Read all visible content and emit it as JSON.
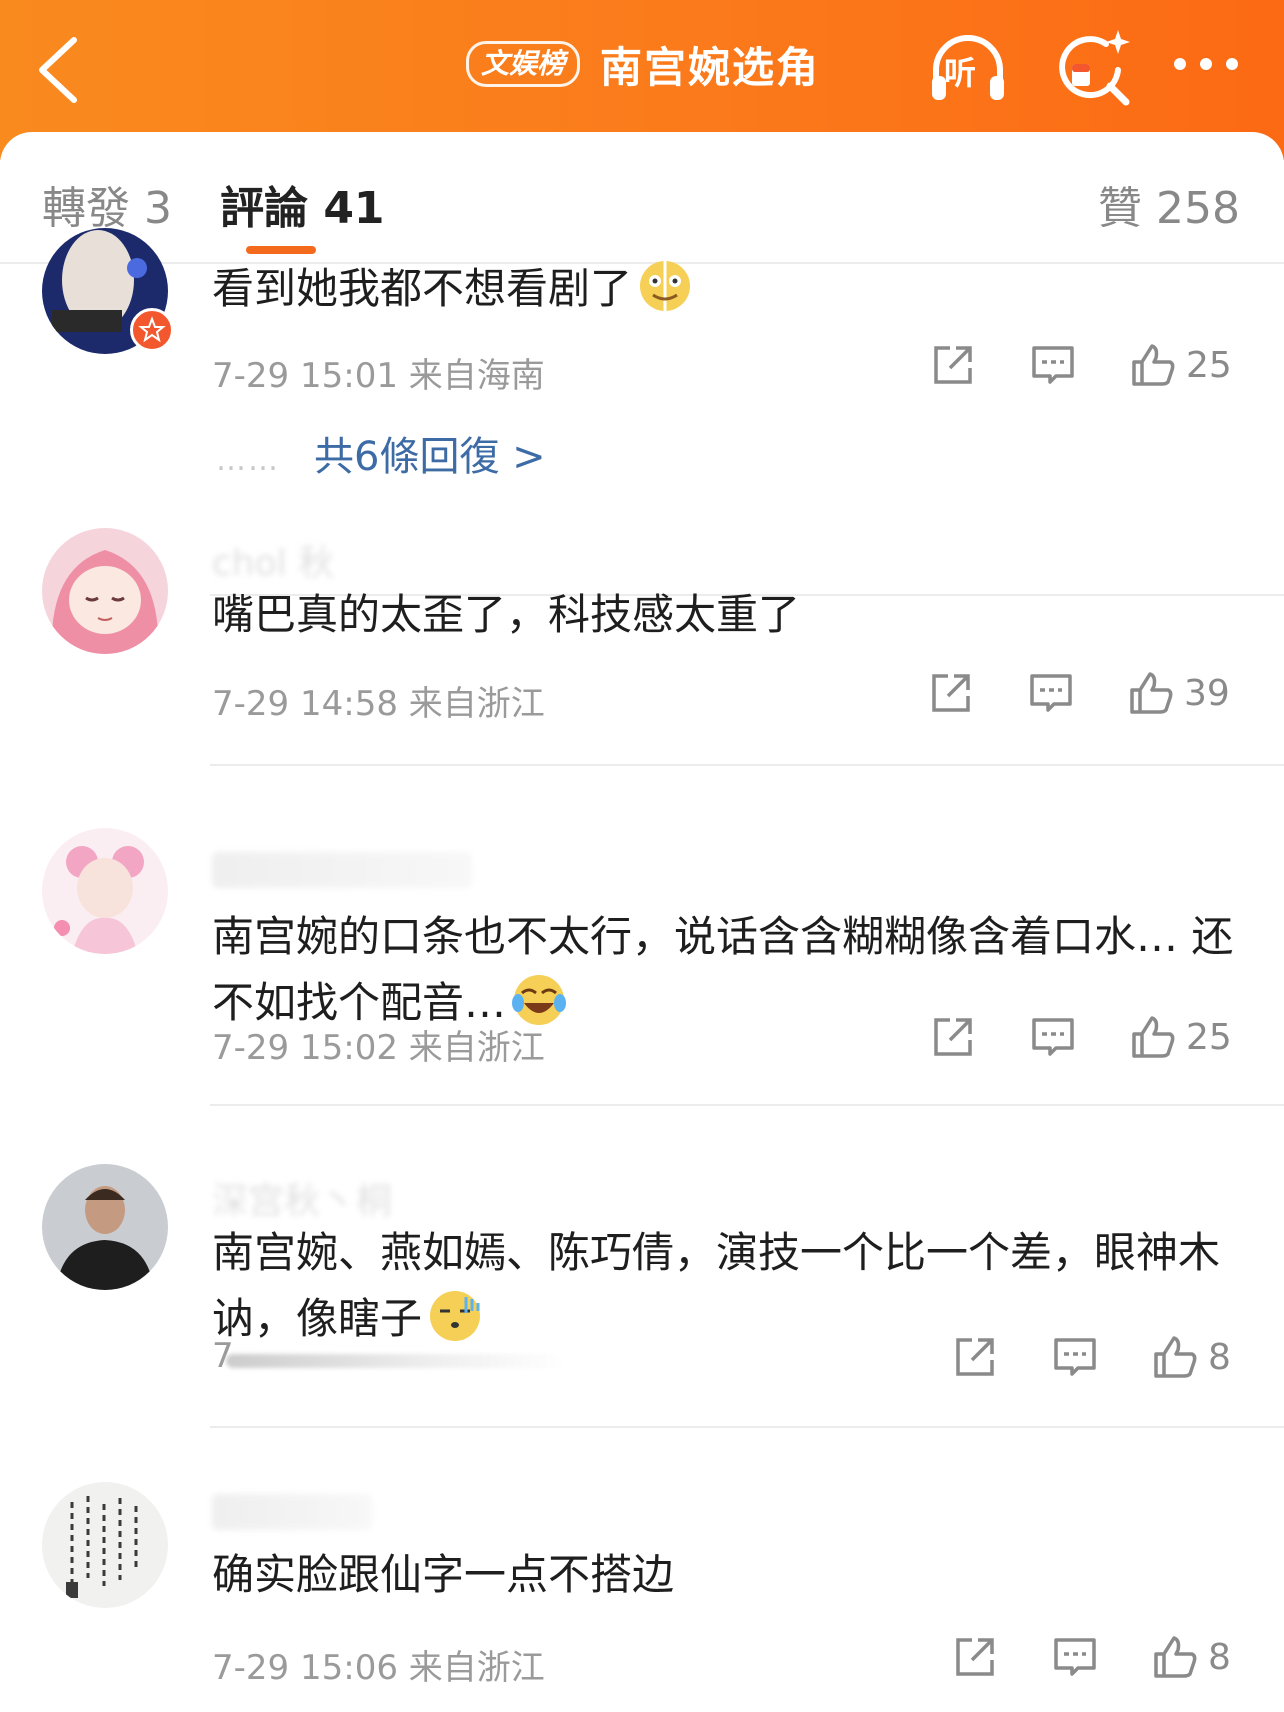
{
  "header": {
    "badge": "文娱榜",
    "title": "南宫婉选角",
    "listen_label": "听",
    "colors": {
      "bg": "#fb7a1b",
      "fg": "#ffffff"
    }
  },
  "tabs": {
    "repost": "轉發 3",
    "comment": "評論 41",
    "like": "贊 258",
    "accent": "#f46a1c"
  },
  "comments": [
    {
      "text": "看到她我都不想看剧了",
      "emoji": "grimace-emoji",
      "time": "7-29 15:01 来自海南",
      "likes": "25",
      "replies": "共6條回復 >",
      "replies_dots": "……"
    },
    {
      "user": "chol 秋",
      "text": "嘴巴真的太歪了，科技感太重了",
      "time": "7-29 14:58 来自浙江",
      "likes": "39"
    },
    {
      "text": "南宫婉的口条也不太行，说话含含糊糊像含着口水… 还不如找个配音…",
      "emoji": "laugh-cry-emoji",
      "time": "7-29 15:02 来自浙江",
      "likes": "25"
    },
    {
      "user": "深宫秋丶桐",
      "text": "南宫婉、燕如嫣、陈巧倩，演技一个比一个差，眼神木讷，像瞎子",
      "emoji": "speechless-emoji",
      "time": "7",
      "likes": "8"
    },
    {
      "text": "确实脸跟仙字一点不搭边",
      "time": "7-29 15:06 来自浙江",
      "likes": "8"
    }
  ]
}
